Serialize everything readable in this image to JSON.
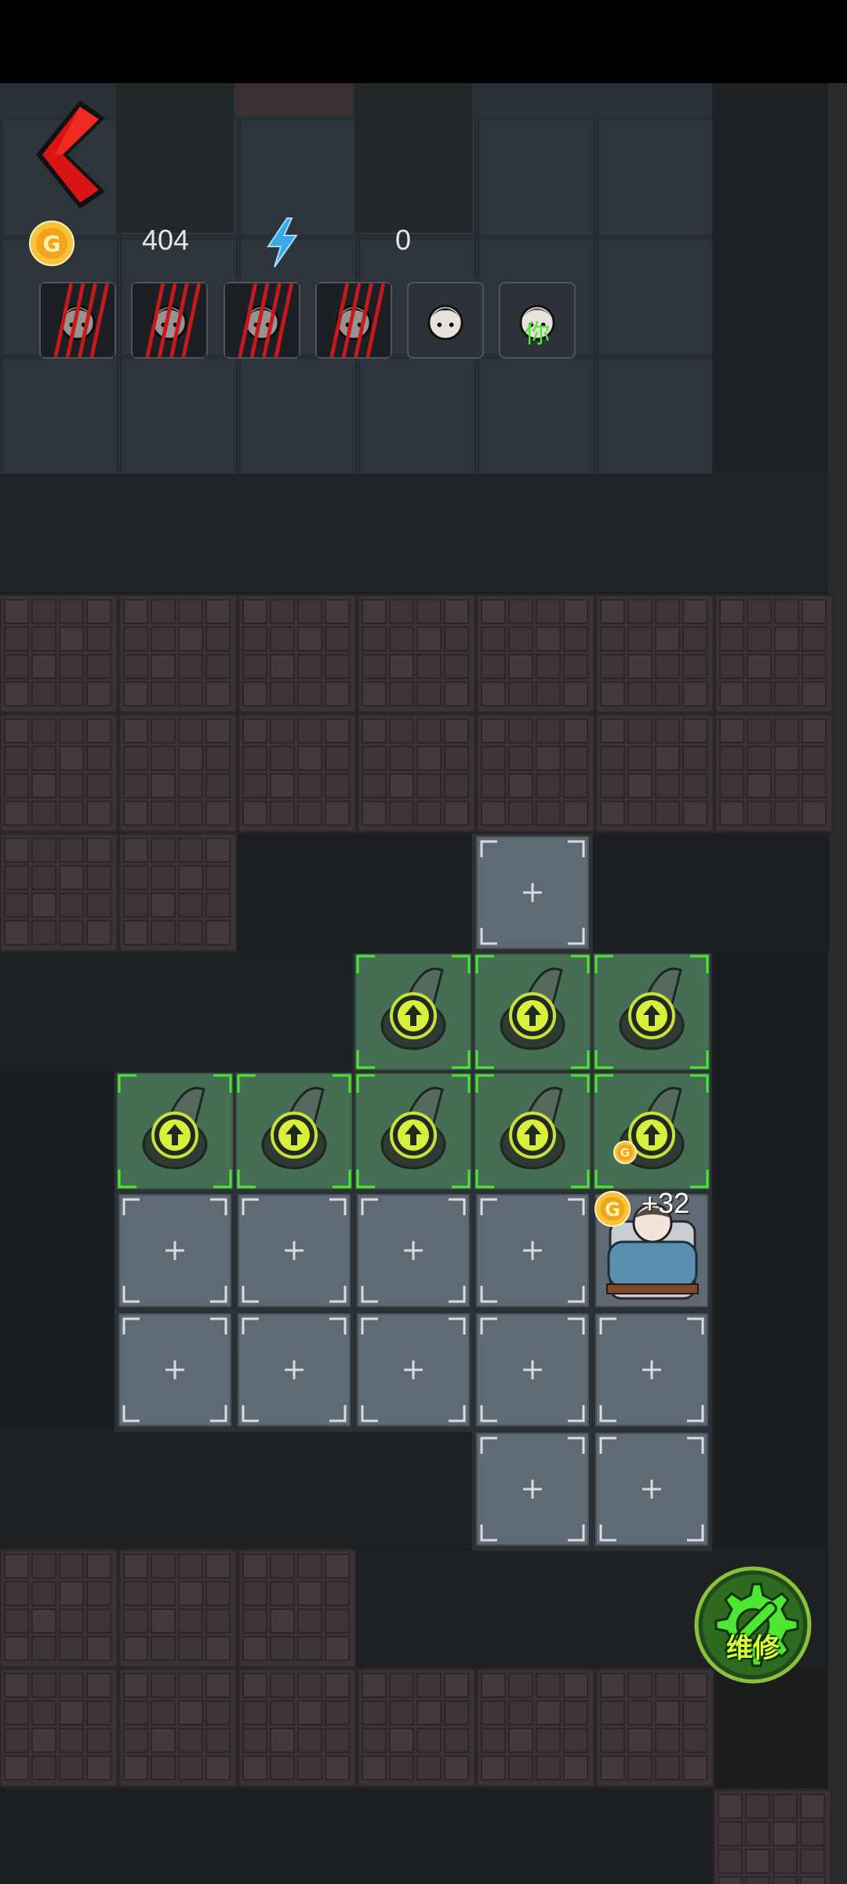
{
  "hud": {
    "gold": "404",
    "energy": "0"
  },
  "icons": {
    "back": "back-arrow-icon",
    "gold": "gold-coin-icon",
    "energy": "lightning-icon",
    "repair": "gear-wrench-icon"
  },
  "avatars": [
    {
      "state": "defeated",
      "label": ""
    },
    {
      "state": "defeated",
      "label": ""
    },
    {
      "state": "defeated",
      "label": ""
    },
    {
      "state": "defeated",
      "label": ""
    },
    {
      "state": "alive",
      "label": ""
    },
    {
      "state": "player",
      "label": "你"
    }
  ],
  "repair": {
    "label": "维修"
  },
  "popup": {
    "reward": "+32"
  },
  "colors": {
    "accent_green": "#4ee832",
    "coin_gold": "#f5b52a",
    "energy_blue": "#3aa7e8",
    "back_red": "#d81414",
    "claw_red": "#c8181c"
  }
}
